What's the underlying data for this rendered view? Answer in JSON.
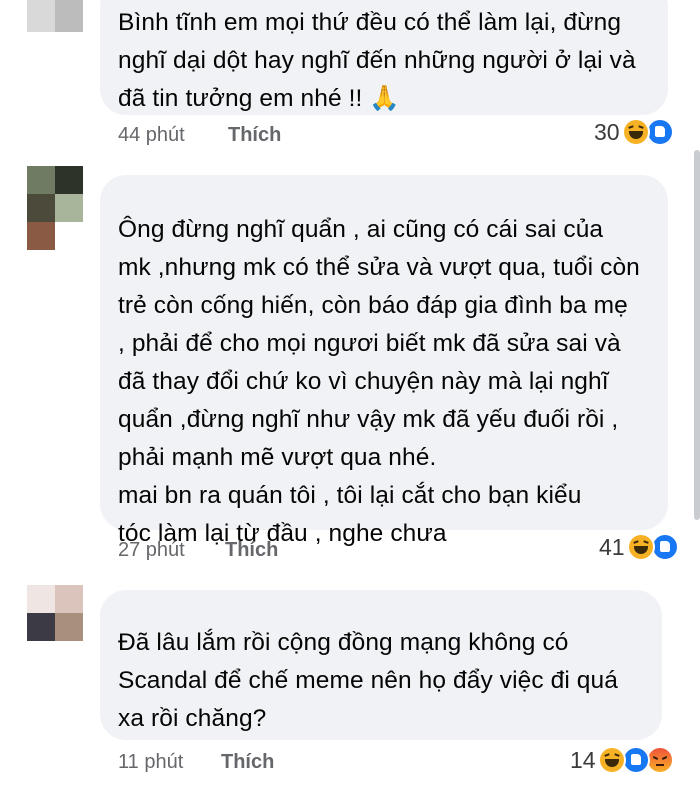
{
  "comments": [
    {
      "text": "Bình tĩnh em mọi thứ đều có thể làm lại, đừng\nnghĩ dại dột hay nghĩ đến những người ở lại và\nđã tin tưởng em nhé !! 🙏",
      "time": "44 phút",
      "like_label": "Thích",
      "reaction_count": "30",
      "reactions": [
        "haha-icon",
        "like-icon"
      ],
      "avatar_colors": [
        "#e8e8e8",
        "#c8c8c8",
        "#f2f2f2",
        "#f2f2f2",
        "#ffffff",
        "#ffffff"
      ]
    },
    {
      "text": "Ông đừng nghĩ quẩn , ai cũng có cái sai của\nmk ,nhưng mk có thể sửa và vượt qua, tuổi còn\ntrẻ còn cống hiến, còn báo đáp gia đình ba mẹ\n, phải để cho mọi ngươi biết mk đã sửa sai và\nđã thay đổi chứ ko vì chuyện này mà lại nghĩ\nquẩn ,đừng nghĩ như vậy mk đã yếu đuối rồi ,\nphải mạnh mẽ vượt qua nhé.\n mai bn  ra quán tôi , tôi lại cắt cho bạn kiểu\n tóc làm lại từ đầu , nghe chưa",
      "time": "27 phút",
      "like_label": "Thích",
      "reaction_count": "41",
      "reactions": [
        "haha-icon",
        "like-icon"
      ],
      "avatar_colors": [
        "#6f7b62",
        "#2d3328",
        "#4c4a3a",
        "#a8b59a",
        "#8a5a45",
        "#ffffff"
      ]
    },
    {
      "text": "Đã lâu lắm rồi cộng đồng mạng không có\nScandal để chế meme nên họ đẩy việc đi quá\nxa rồi chăng?",
      "time": "11 phút",
      "like_label": "Thích",
      "reaction_count": "14",
      "reactions": [
        "haha-icon",
        "like-icon",
        "angry-icon"
      ],
      "avatar_colors": [
        "#efe6e4",
        "#dbc4bb",
        "#3c3a44",
        "#a9907e",
        "#ffffff",
        "#ffffff"
      ]
    }
  ]
}
